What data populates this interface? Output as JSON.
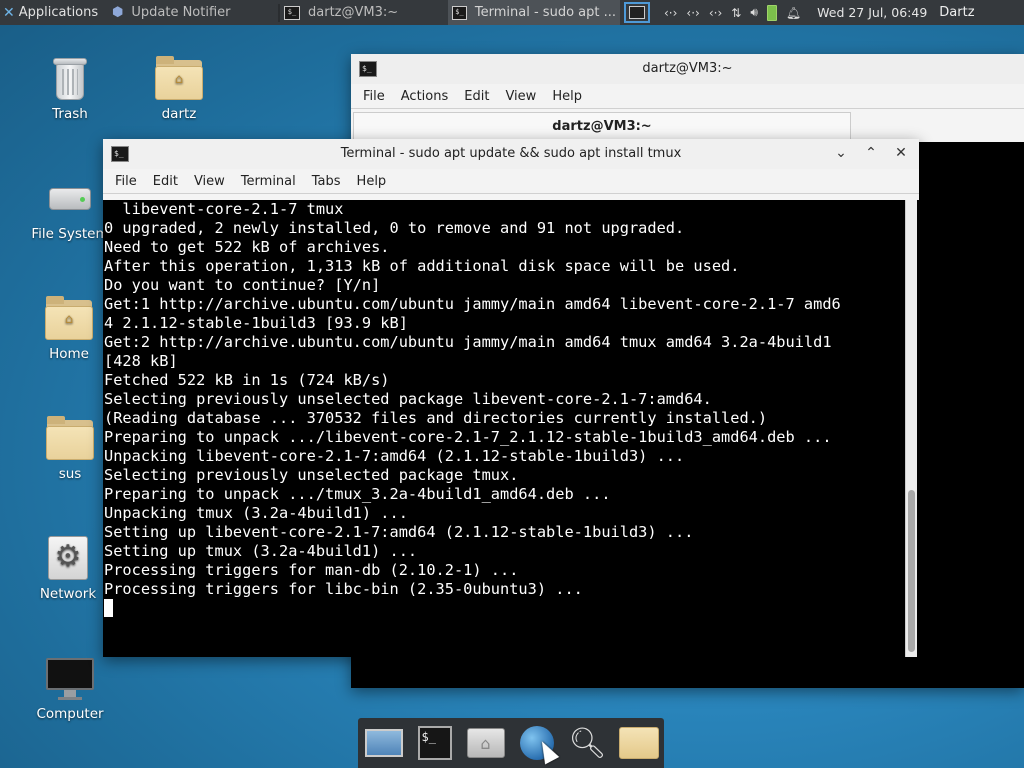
{
  "top_panel": {
    "applications_label": "Applications",
    "tasks": [
      {
        "label": "Update Notifier",
        "icon": "update-notifier-icon"
      },
      {
        "label": "dartz@VM3:~",
        "icon": "terminal-icon"
      },
      {
        "label": "Terminal - sudo apt ...",
        "icon": "terminal-icon"
      }
    ],
    "clock": "Wed 27 Jul, 06:49",
    "user": "Dartz"
  },
  "desktop_icons": [
    {
      "label": "Trash",
      "icon": "trash-icon"
    },
    {
      "label": "dartz",
      "icon": "home-folder-icon"
    },
    {
      "label": "File System",
      "icon": "drive-icon"
    },
    {
      "label": "Home",
      "icon": "home-folder-icon"
    },
    {
      "label": "sus",
      "icon": "folder-icon"
    },
    {
      "label": "Network",
      "icon": "network-icon"
    },
    {
      "label": "Computer",
      "icon": "computer-icon"
    }
  ],
  "back_window": {
    "title": "dartz@VM3:~",
    "tab_label": "dartz@VM3:~",
    "menu": [
      "File",
      "Actions",
      "Edit",
      "View",
      "Help"
    ]
  },
  "front_window": {
    "title": "Terminal - sudo apt update && sudo apt install tmux",
    "menu": [
      "File",
      "Edit",
      "View",
      "Terminal",
      "Tabs",
      "Help"
    ],
    "terminal_lines": [
      "  libevent-core-2.1-7 tmux",
      "0 upgraded, 2 newly installed, 0 to remove and 91 not upgraded.",
      "Need to get 522 kB of archives.",
      "After this operation, 1,313 kB of additional disk space will be used.",
      "Do you want to continue? [Y/n]",
      "Get:1 http://archive.ubuntu.com/ubuntu jammy/main amd64 libevent-core-2.1-7 amd6",
      "4 2.1.12-stable-1build3 [93.9 kB]",
      "Get:2 http://archive.ubuntu.com/ubuntu jammy/main amd64 tmux amd64 3.2a-4build1",
      "[428 kB]",
      "Fetched 522 kB in 1s (724 kB/s)",
      "Selecting previously unselected package libevent-core-2.1-7:amd64.",
      "(Reading database ... 370532 files and directories currently installed.)",
      "Preparing to unpack .../libevent-core-2.1-7_2.1.12-stable-1build3_amd64.deb ...",
      "Unpacking libevent-core-2.1-7:amd64 (2.1.12-stable-1build3) ...",
      "Selecting previously unselected package tmux.",
      "Preparing to unpack .../tmux_3.2a-4build1_amd64.deb ...",
      "Unpacking tmux (3.2a-4build1) ...",
      "Setting up libevent-core-2.1-7:amd64 (2.1.12-stable-1build3) ...",
      "Setting up tmux (3.2a-4build1) ...",
      "Processing triggers for man-db (2.10.2-1) ...",
      "Processing triggers for libc-bin (2.35-0ubuntu3) ..."
    ]
  },
  "dock_items": [
    {
      "icon": "show-desktop-icon"
    },
    {
      "icon": "terminal-icon"
    },
    {
      "icon": "file-manager-icon"
    },
    {
      "icon": "web-browser-icon"
    },
    {
      "icon": "search-icon"
    },
    {
      "icon": "folder-icon"
    }
  ]
}
